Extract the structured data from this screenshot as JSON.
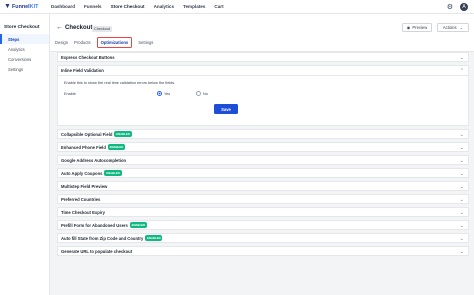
{
  "brand": {
    "name_main": "Funnel",
    "name_accent": "KIT"
  },
  "nav": [
    "Dashboard",
    "Funnels",
    "Store Checkout",
    "Analytics",
    "Templates",
    "Cart"
  ],
  "avatar_letter": "A",
  "sidebar": {
    "title": "Store Checkout",
    "items": [
      {
        "label": "Steps",
        "active": true
      },
      {
        "label": "Analytics",
        "active": false
      },
      {
        "label": "Conversions",
        "active": false
      },
      {
        "label": "Settings",
        "active": false
      }
    ]
  },
  "page": {
    "title": "Checkout",
    "tag": "Checkout",
    "preview_label": "Preview",
    "actions_label": "Actions",
    "tabs": [
      {
        "label": "Design",
        "active": false
      },
      {
        "label": "Products",
        "active": false
      },
      {
        "label": "Optimizations",
        "active": true
      },
      {
        "label": "Settings",
        "active": false
      }
    ]
  },
  "sections": {
    "express": {
      "label": "Express Checkout Buttons"
    },
    "inline": {
      "label": "Inline Field Validation",
      "description": "Enable this to show the real time validation errors below the fields.",
      "enable_label": "Enable",
      "yes_label": "Yes",
      "no_label": "No",
      "save_label": "Save"
    },
    "rows": [
      {
        "label": "Collapsible Optional Field",
        "badge": "ENABLED"
      },
      {
        "label": "Enhanced Phone Field",
        "badge": "ENABLED"
      },
      {
        "label": "Google Address Autocompletion",
        "badge": ""
      },
      {
        "label": "Auto Apply Coupons",
        "badge": "ENABLED"
      },
      {
        "label": "Multistep Field Preview",
        "badge": ""
      },
      {
        "label": "Preferred Countries",
        "badge": ""
      },
      {
        "label": "Time Checkout Expiry",
        "badge": ""
      },
      {
        "label": "Prefill Form for Abandoned Users",
        "badge": "ENABLED"
      },
      {
        "label": "Auto fill State from Zip Code and Country",
        "badge": "ENABLED"
      },
      {
        "label": "Generate URL to populate checkout",
        "badge": ""
      }
    ]
  }
}
